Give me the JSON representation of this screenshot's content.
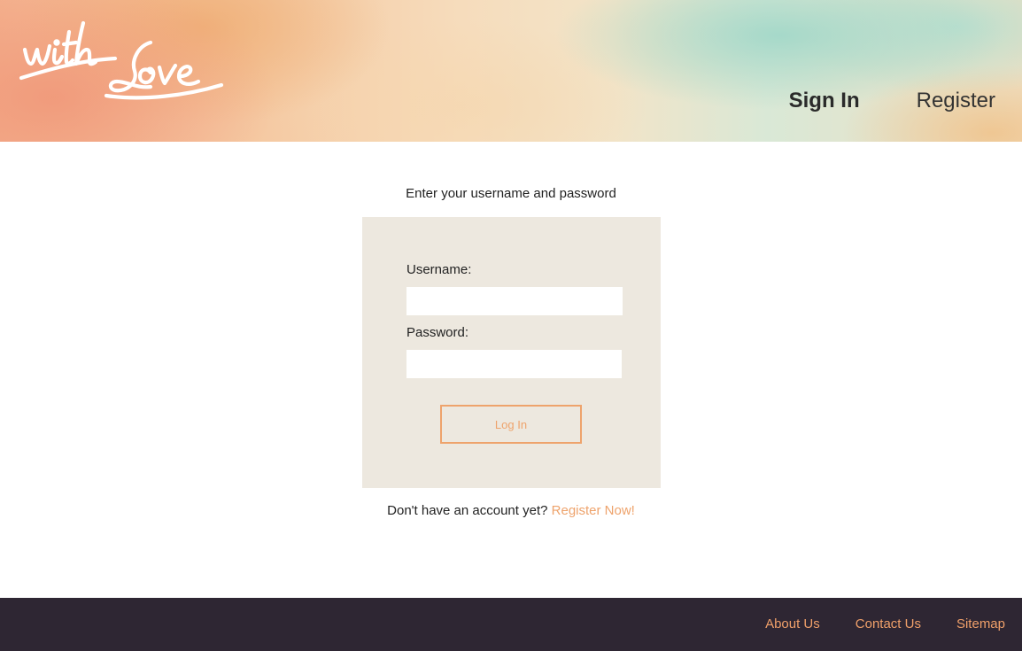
{
  "header": {
    "logo_text": "with Love",
    "nav": {
      "sign_in": "Sign In",
      "register": "Register"
    }
  },
  "main": {
    "intro": "Enter your username and password",
    "form": {
      "username_label": "Username:",
      "username_value": "",
      "password_label": "Password:",
      "password_value": "",
      "login_button": "Log In"
    },
    "register_prompt": "Don't have an account yet?",
    "register_link": "Register Now!"
  },
  "footer": {
    "links": [
      "About Us",
      "Contact Us",
      "Sitemap"
    ]
  },
  "colors": {
    "accent": "#eea36c",
    "form_bg": "#ede8df",
    "footer_bg": "#2e2633",
    "text": "#222222"
  }
}
